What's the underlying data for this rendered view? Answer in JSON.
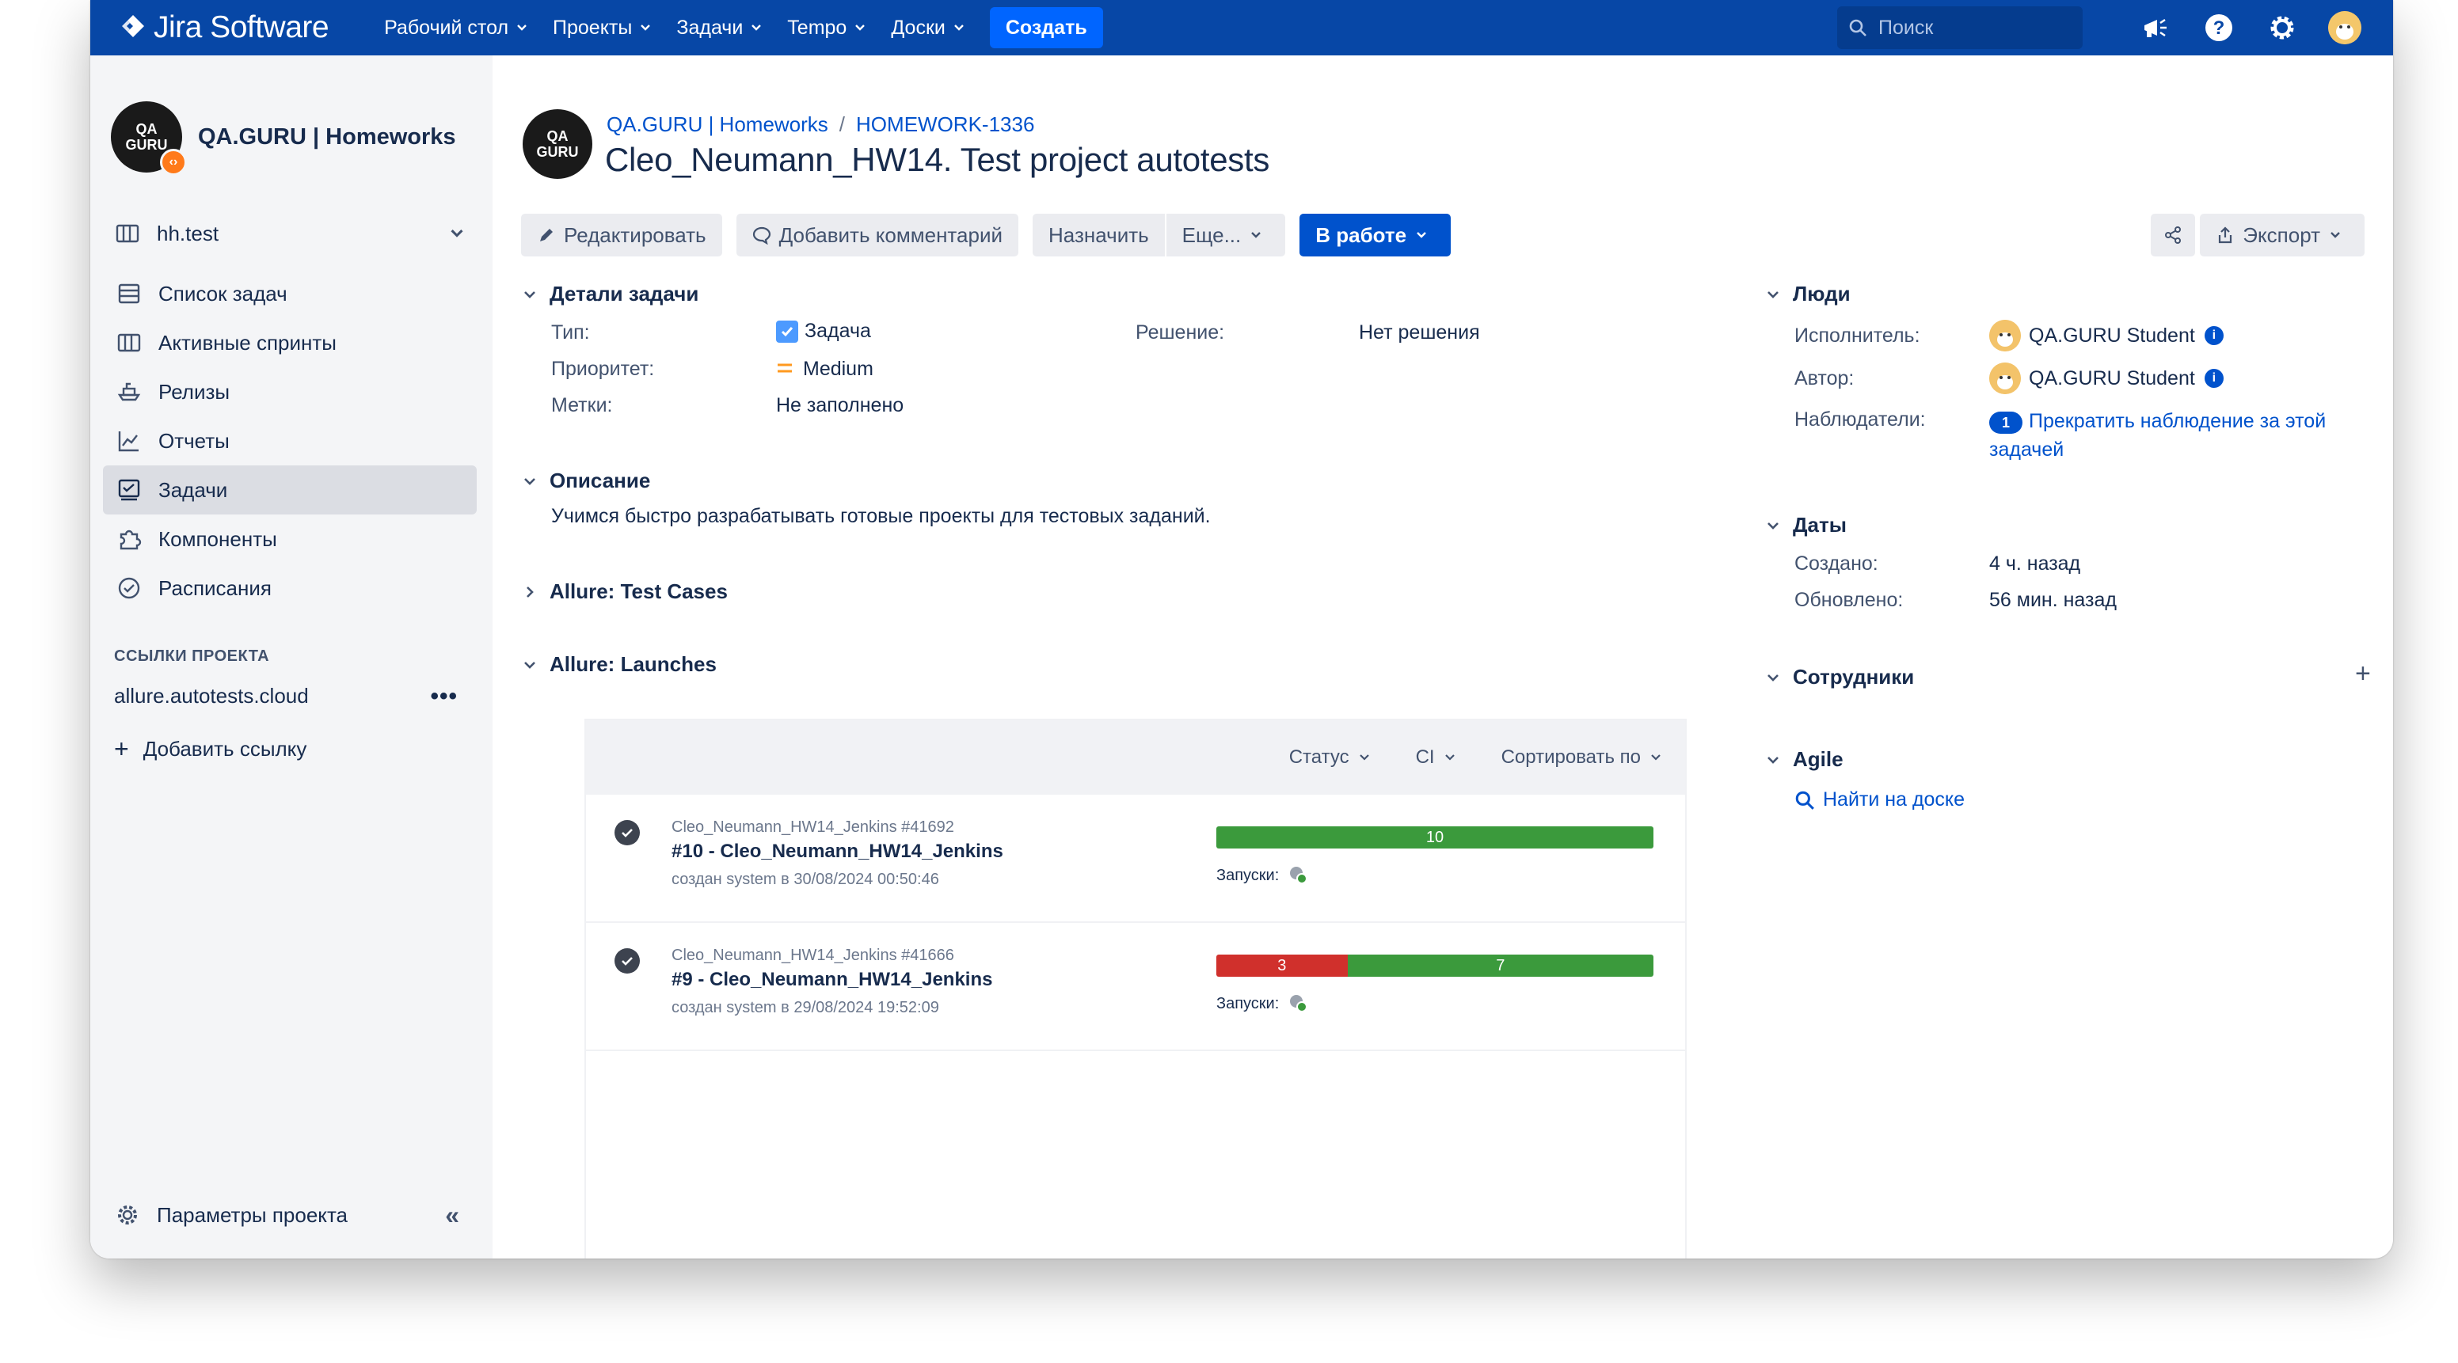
{
  "topnav": {
    "logo": "Jira Software",
    "items": [
      "Рабочий стол",
      "Проекты",
      "Задачи",
      "Tempo",
      "Доски"
    ],
    "create": "Создать",
    "search_placeholder": "Поиск",
    "brand_color": "#0747a6"
  },
  "sidebar": {
    "project_name": "QA.GURU | Homeworks",
    "avatar_text": "QA GURU",
    "board": "hh.test",
    "items": [
      {
        "label": "Список задач",
        "icon": "backlog-icon"
      },
      {
        "label": "Активные спринты",
        "icon": "sprint-icon"
      },
      {
        "label": "Релизы",
        "icon": "ship-icon"
      },
      {
        "label": "Отчеты",
        "icon": "chart-icon"
      },
      {
        "label": "Задачи",
        "icon": "issues-icon"
      },
      {
        "label": "Компоненты",
        "icon": "puzzle-icon"
      },
      {
        "label": "Расписания",
        "icon": "clock-icon"
      }
    ],
    "active_item": "Задачи",
    "links_section": "ССЫЛКИ ПРОЕКТА",
    "link": "allure.autotests.cloud",
    "add_link": "Добавить ссылку",
    "settings": "Параметры проекта"
  },
  "issue": {
    "breadcrumb_project": "QA.GURU | Homeworks",
    "breadcrumb_key": "HOMEWORK-1336",
    "title": "Cleo_Neumann_HW14. Test project autotests",
    "toolbar": {
      "edit": "Редактировать",
      "comment": "Добавить комментарий",
      "assign": "Назначить",
      "more": "Еще...",
      "status": "В работе",
      "export": "Экспорт"
    },
    "details": {
      "heading": "Детали задачи",
      "type_label": "Тип:",
      "type_value": "Задача",
      "priority_label": "Приоритет:",
      "priority_value": "Medium",
      "labels_label": "Метки:",
      "labels_value": "Не заполнено",
      "resolution_label": "Решение:",
      "resolution_value": "Нет решения"
    },
    "description": {
      "heading": "Описание",
      "text": "Учимся быстро разрабатывать готовые проекты для тестовых заданий."
    },
    "allure_cases": "Allure: Test Cases",
    "allure_launches": "Allure: Launches",
    "filters": [
      "Статус",
      "CI",
      "Сортировать по"
    ],
    "launches": [
      {
        "job": "Cleo_Neumann_HW14_Jenkins #41692",
        "name": "#10 - Cleo_Neumann_HW14_Jenkins",
        "meta": "создан system в 30/08/2024 00:50:46",
        "passed": 10,
        "failed": 0,
        "runs_label": "Запуски:"
      },
      {
        "job": "Cleo_Neumann_HW14_Jenkins #41666",
        "name": "#9 - Cleo_Neumann_HW14_Jenkins",
        "meta": "создан system в 29/08/2024 19:52:09",
        "passed": 7,
        "failed": 3,
        "runs_label": "Запуски:"
      }
    ]
  },
  "people": {
    "heading": "Люди",
    "assignee_label": "Исполнитель:",
    "assignee": "QA.GURU Student",
    "reporter_label": "Автор:",
    "reporter": "QA.GURU Student",
    "watchers_label": "Наблюдатели:",
    "watchers_count": "1",
    "watchers_link": "Прекратить наблюдение за этой задачей"
  },
  "dates": {
    "heading": "Даты",
    "created_label": "Создано:",
    "created": "4 ч. назад",
    "updated_label": "Обновлено:",
    "updated": "56 мин. назад"
  },
  "employees": {
    "heading": "Сотрудники"
  },
  "agile": {
    "heading": "Agile",
    "link": "Найти на доске"
  },
  "colors": {
    "pass": "#3b9a3c",
    "fail": "#d0302c",
    "link": "#0052cc"
  }
}
